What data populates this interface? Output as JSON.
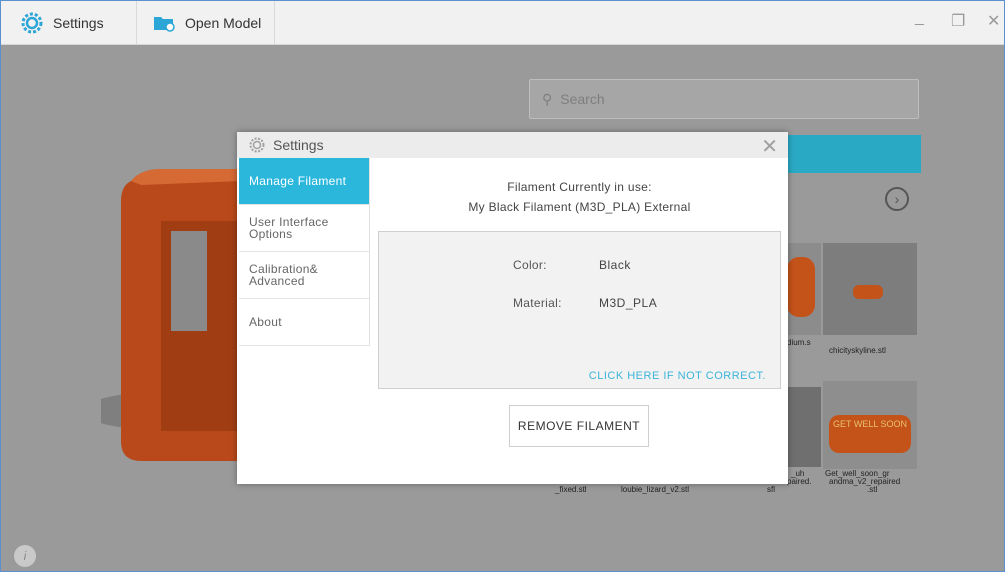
{
  "topbar": {
    "settings_label": "Settings",
    "open_model_label": "Open Model",
    "minimize": "_",
    "restore": "❐",
    "close": "✕"
  },
  "background": {
    "search_placeholder": "Search",
    "thumbnails": [
      "dium.s",
      "chicityskyline.stl",
      "_fixed.stl",
      "loubie_lizard_v2.stl",
      "_uh",
      "paired.",
      "sfl",
      "Get_well_soon_gr",
      "andma_v2_repaired",
      ".stl"
    ],
    "thumb_sign_text": "GET WELL SOON"
  },
  "dialog": {
    "title": "Settings",
    "sidebar": [
      {
        "label": "Manage Filament",
        "active": true
      },
      {
        "label": "User Interface Options",
        "active": false
      },
      {
        "label": "Calibration& Advanced",
        "active": false
      },
      {
        "label": "About",
        "active": false
      }
    ],
    "filament": {
      "heading": "Filament Currently in use:",
      "name": "My Black Filament (M3D_PLA) External",
      "color_label": "Color:",
      "color_value": "Black",
      "material_label": "Material:",
      "material_value": "M3D_PLA",
      "not_correct_link": "CLICK HERE IF NOT CORRECT.",
      "remove_button": "REMOVE FILAMENT"
    }
  },
  "colors": {
    "accent": "#2bb7dc",
    "link": "#3cb4d8",
    "model_orange": "#c4531a"
  }
}
